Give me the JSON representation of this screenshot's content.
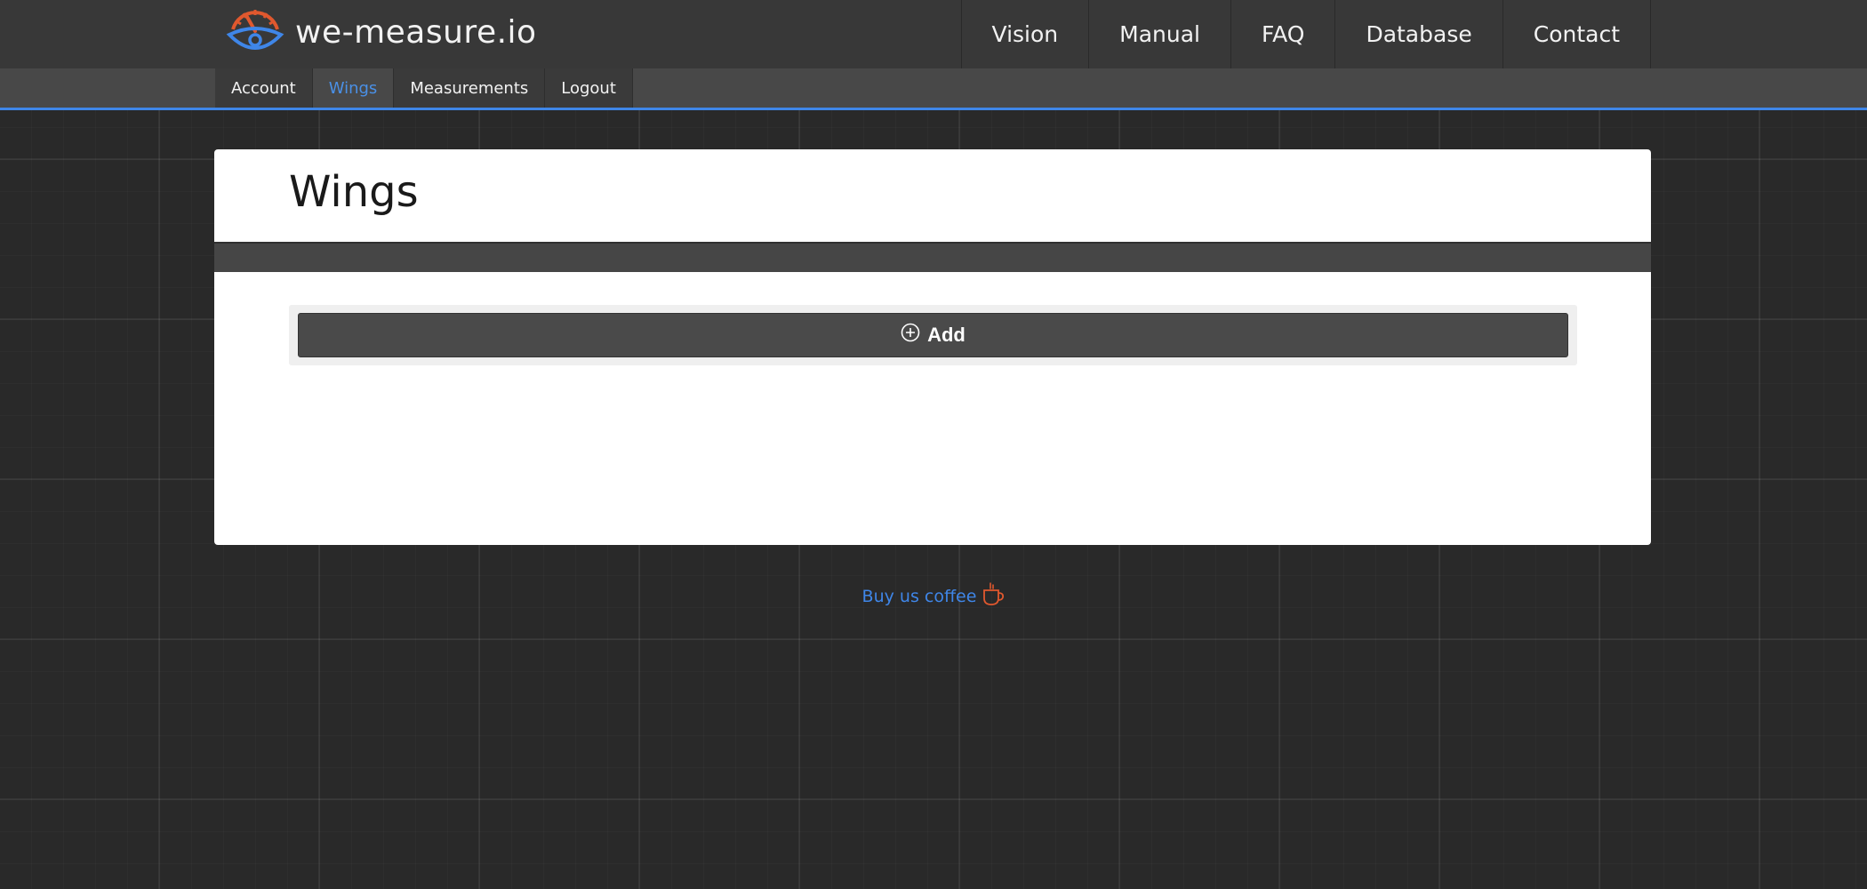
{
  "brand": {
    "name": "we-measure.io",
    "logo_icon": "gauge-eye-logo",
    "accent_orange": "#e0582e",
    "accent_blue": "#3f86e8"
  },
  "main_nav": {
    "items": [
      {
        "label": "Vision"
      },
      {
        "label": "Manual"
      },
      {
        "label": "FAQ"
      },
      {
        "label": "Database"
      },
      {
        "label": "Contact"
      }
    ]
  },
  "sub_nav": {
    "items": [
      {
        "label": "Account",
        "active": false
      },
      {
        "label": "Wings",
        "active": true
      },
      {
        "label": "Measurements",
        "active": false
      },
      {
        "label": "Logout",
        "active": false
      }
    ]
  },
  "content": {
    "title": "Wings",
    "add_button": {
      "label": "Add",
      "icon": "plus-circle-icon"
    }
  },
  "footer": {
    "coffee_label": "Buy us coffee",
    "coffee_icon": "coffee-cup-icon"
  }
}
